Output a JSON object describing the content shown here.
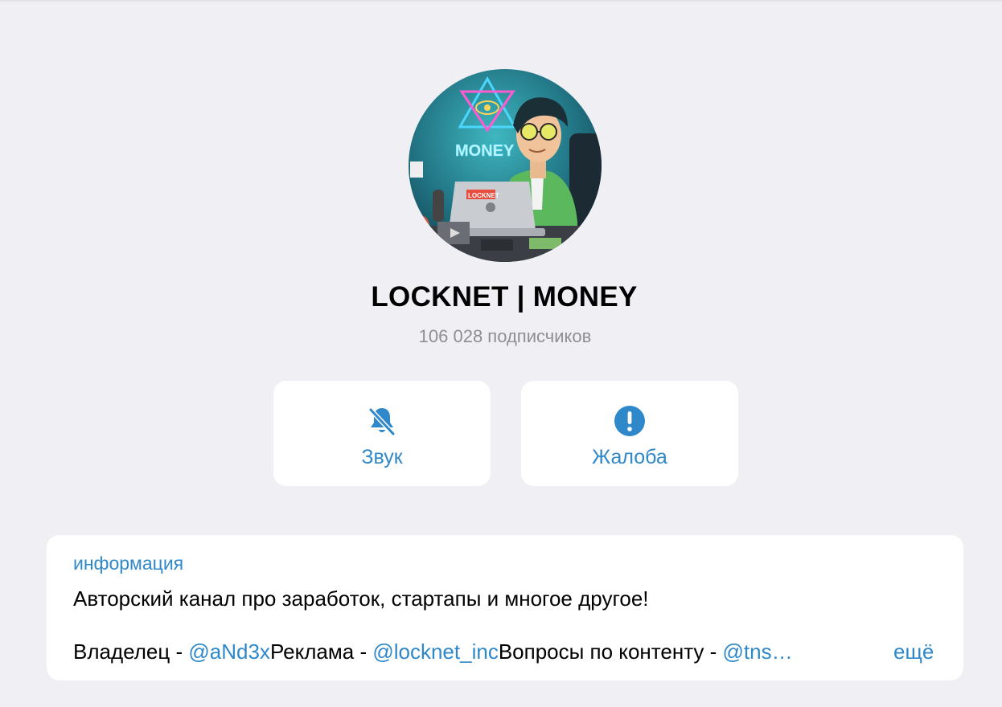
{
  "channel": {
    "name": "LOCKNET | MONEY",
    "subscribers": "106 028 подписчиков",
    "avatar": {
      "neon_text": "MONEY",
      "laptop_sticker": "LOCKNET"
    }
  },
  "actions": [
    {
      "label": "Звук",
      "icon": "bell-slash-icon"
    },
    {
      "label": "Жалоба",
      "icon": "exclamation-circle-icon"
    }
  ],
  "info": {
    "header": "информация",
    "description": "Авторский канал про заработок, стартапы и многое другое!",
    "owner_label": "Владелец - ",
    "owner_link": "@aNd3x",
    "ads_label": "Реклама - ",
    "ads_link": "@locknet_inc",
    "content_label": "Вопросы по контенту - ",
    "content_link": "@tns…",
    "more": "ещё"
  },
  "colors": {
    "background": "#efeff4",
    "accent": "#2f88c9",
    "secondary_text": "#8e8e93"
  }
}
